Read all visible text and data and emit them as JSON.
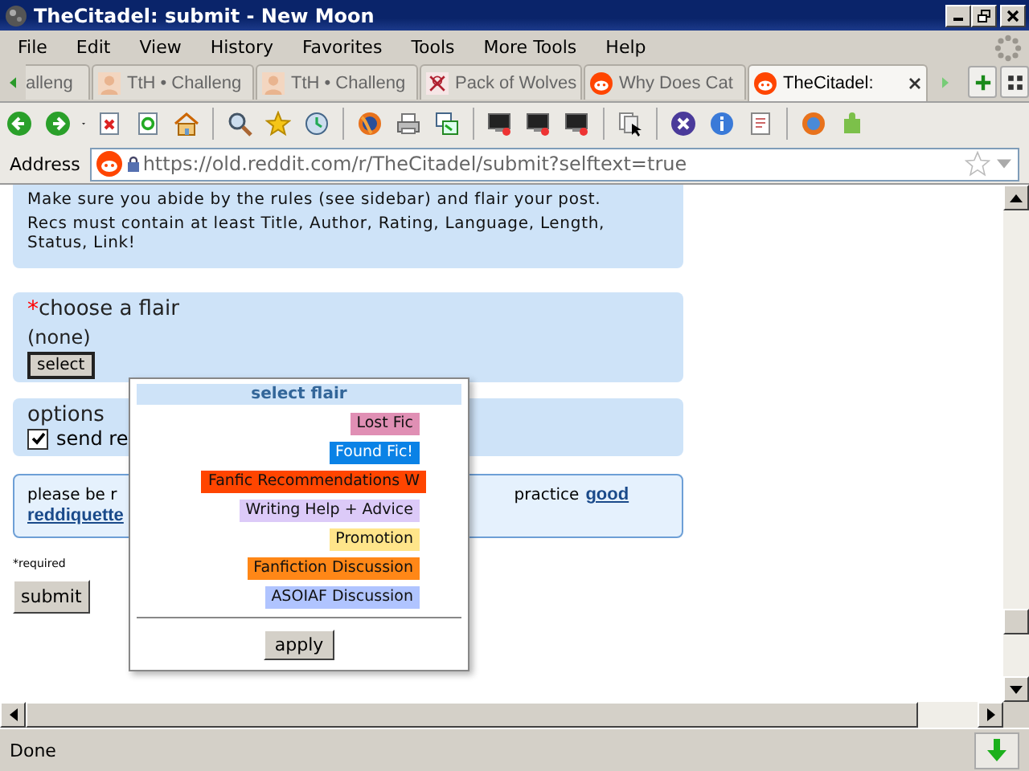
{
  "window": {
    "title": "TheCitadel: submit - New Moon"
  },
  "menu": [
    {
      "label": "File"
    },
    {
      "label": "Edit"
    },
    {
      "label": "View"
    },
    {
      "label": "History"
    },
    {
      "label": "Favorites"
    },
    {
      "label": "Tools"
    },
    {
      "label": "More Tools"
    },
    {
      "label": "Help"
    }
  ],
  "tabs": [
    {
      "label": "alleng",
      "kind": "plain",
      "selected": false
    },
    {
      "label": "TtH • Challeng",
      "kind": "avatar",
      "selected": false
    },
    {
      "label": "TtH • Challeng",
      "kind": "avatar",
      "selected": false
    },
    {
      "label": "Pack of Wolves",
      "kind": "wolf",
      "selected": false
    },
    {
      "label": "Why Does Cat",
      "kind": "reddit",
      "selected": false
    },
    {
      "label": "TheCitadel:",
      "kind": "reddit",
      "selected": true
    }
  ],
  "address": {
    "label": "Address",
    "value": "https://old.reddit.com/r/TheCitadel/submit?selftext=true"
  },
  "rules": [
    "Make sure you abide by the rules (see sidebar) and flair your post.",
    "Recs must contain at least Title, Author, Rating, Language, Length, Status, Link!"
  ],
  "flair_section": {
    "required_mark": "*",
    "title": "choose a flair",
    "value": "(none)",
    "button": "select"
  },
  "options": {
    "title": "options",
    "checkbox": {
      "label": "send re",
      "checked": true
    }
  },
  "notice": {
    "left": "please be r",
    "right": "practice",
    "links": [
      "good",
      "reddiquette"
    ]
  },
  "required_note": "*required",
  "submit": "submit",
  "flair_popup": {
    "title": "select flair",
    "flairs": [
      {
        "label": "Lost Fic",
        "color": "#e08fb4"
      },
      {
        "label": "Found Fic!",
        "color": "#0a82e6"
      },
      {
        "label": "Fanfic Recommendations W",
        "color": "#ff4500"
      },
      {
        "label": "Writing Help + Advice",
        "color": "#dccaf8"
      },
      {
        "label": "Promotion",
        "color": "#ffe58a"
      },
      {
        "label": "Fanfiction Discussion",
        "color": "#ff8717"
      },
      {
        "label": "ASOIAF Discussion",
        "color": "#b0c4ff"
      }
    ],
    "button": "apply"
  },
  "status_bar": {
    "text": "Done"
  }
}
